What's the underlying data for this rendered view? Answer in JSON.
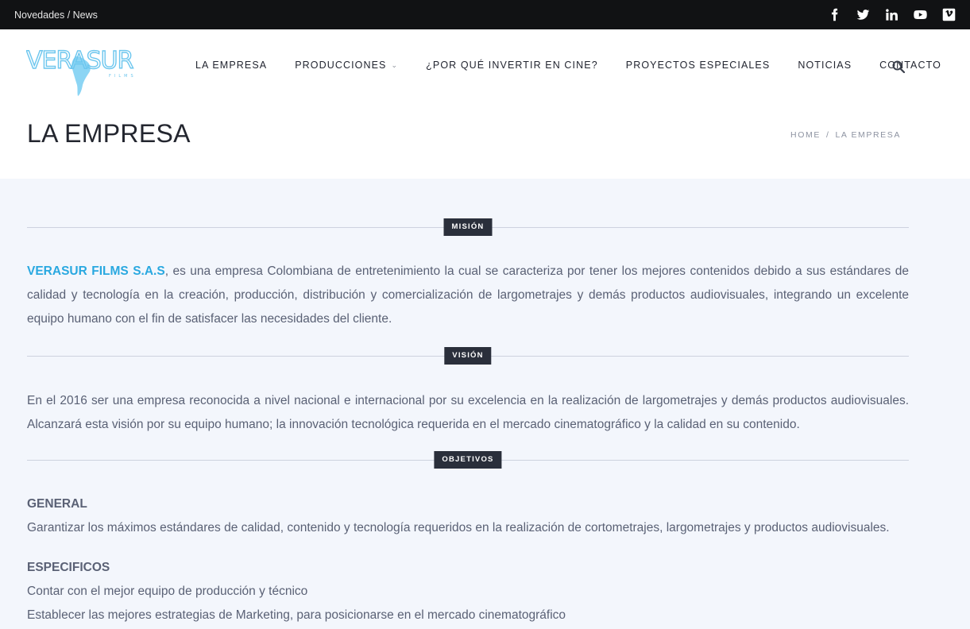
{
  "topbar": {
    "news_link": "Novedades / News",
    "socials": [
      {
        "icon": "facebook-icon"
      },
      {
        "icon": "twitter-icon"
      },
      {
        "icon": "linkedin-icon"
      },
      {
        "icon": "youtube-icon"
      },
      {
        "icon": "vimeo-icon"
      }
    ]
  },
  "header": {
    "logo_text": "VERASUR",
    "logo_sub": "FILMS",
    "nav": [
      {
        "label": "LA EMPRESA"
      },
      {
        "label": "PRODUCCIONES"
      },
      {
        "label": "¿POR QUÉ INVERTIR EN CINE?"
      },
      {
        "label": "PROYECTOS ESPECIALES"
      },
      {
        "label": "NOTICIAS"
      },
      {
        "label": "CONTACTO"
      }
    ],
    "page_title": "LA EMPRESA",
    "breadcrumb": {
      "home": "HOME",
      "separator": "/",
      "current": "LA EMPRESA"
    }
  },
  "colors": {
    "accent": "#29a8e0",
    "dark": "#2a2f3b",
    "topbar": "#111214"
  },
  "sections": {
    "mision": {
      "tag": "MISIÓN",
      "brand": "VERASUR FILMS S.A.S",
      "text": ", es una empresa Colombiana de entretenimiento la cual se caracteriza por tener los mejores contenidos debido a sus estándares de calidad y tecnología en la creación, producción, distribución y comercialización de largometrajes y demás productos audiovisuales, integrando un excelente equipo humano con el fin de satisfacer las necesidades del cliente."
    },
    "vision": {
      "tag": "VISIÓN",
      "text": "En el 2016 ser una empresa reconocida a nivel nacional e internacional por su excelencia en la realización de largometrajes y demás productos audiovisuales. Alcanzará esta visión por su equipo humano; la innovación tecnológica requerida en el mercado cinematográfico y la calidad en su contenido."
    },
    "objetivos": {
      "tag": "OBJETIVOS",
      "general_heading": "GENERAL",
      "general_text": "Garantizar los máximos estándares de calidad, contenido y tecnología requeridos en la realización de cortometrajes, largometrajes y productos audiovisuales.",
      "especificos_heading": "ESPECIFICOS",
      "especificos": [
        "Contar con el mejor equipo de producción y técnico",
        "Establecer las mejores estrategias de Marketing, para posicionarse en el mercado cinematográfico"
      ]
    }
  }
}
